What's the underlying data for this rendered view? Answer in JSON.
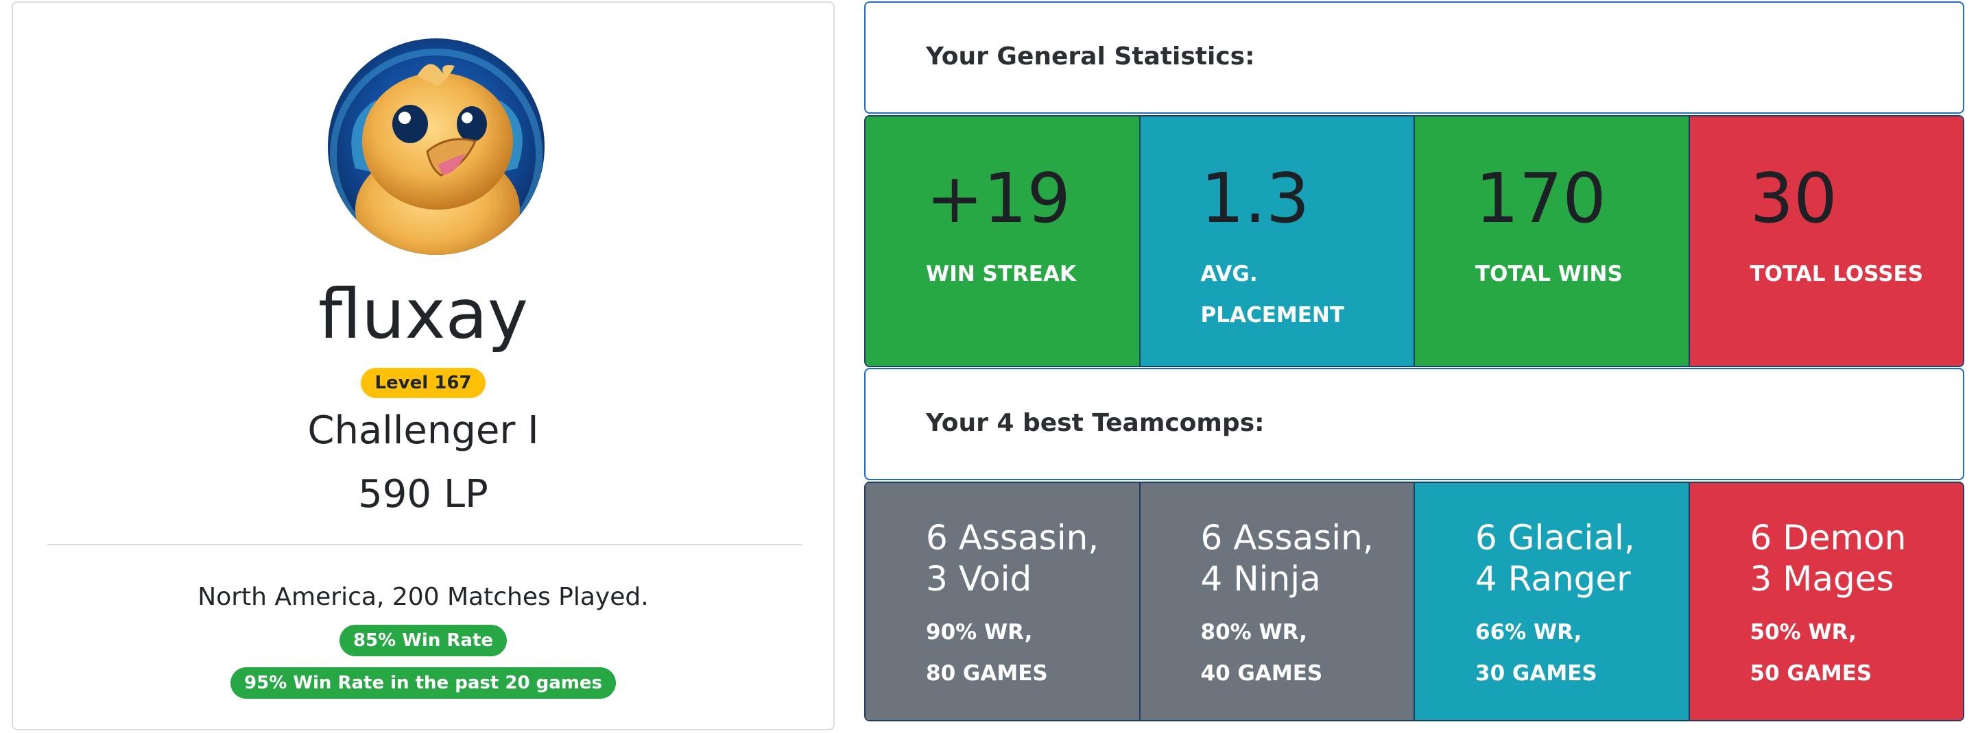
{
  "profile": {
    "username": "fluxay",
    "level_badge": "Level 167",
    "rank": "Challenger I",
    "lp": "590 LP",
    "region_matches": "North America, 200 Matches Played.",
    "win_rate_badge": "85% Win Rate",
    "recent_win_rate_badge": "95% Win Rate in the past 20 games"
  },
  "general_stats": {
    "title": "Your General Statistics:",
    "tiles": [
      {
        "value": "+19",
        "label_line1": "WIN STREAK",
        "label_line2": "",
        "color": "#28a745"
      },
      {
        "value": "1.3",
        "label_line1": "AVG.",
        "label_line2": "PLACEMENT",
        "color": "#17a2b8"
      },
      {
        "value": "170",
        "label_line1": "TOTAL WINS",
        "label_line2": "",
        "color": "#28a745"
      },
      {
        "value": "30",
        "label_line1": "TOTAL LOSSES",
        "label_line2": "",
        "color": "#dc3545"
      }
    ]
  },
  "teamcomps": {
    "title": "Your 4 best Teamcomps:",
    "items": [
      {
        "line1": "6 Assasin,",
        "line2": "3 Void",
        "wr": "90% WR,",
        "games": "80 GAMES",
        "color": "#6c757d"
      },
      {
        "line1": "6 Assasin,",
        "line2": "4 Ninja",
        "wr": "80% WR,",
        "games": "40 GAMES",
        "color": "#6c757d"
      },
      {
        "line1": "6 Glacial,",
        "line2": "4 Ranger",
        "wr": "66% WR,",
        "games": "30 GAMES",
        "color": "#17a2b8"
      },
      {
        "line1": "6 Demon",
        "line2": "3 Mages",
        "wr": "50% WR,",
        "games": "50 GAMES",
        "color": "#dc3545"
      }
    ]
  },
  "icons": {
    "avatar": "baby-bird-avatar-image"
  }
}
